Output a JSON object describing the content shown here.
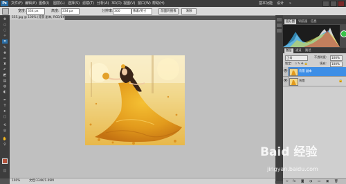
{
  "app": {
    "logo": "Ps"
  },
  "menu": [
    "文件(F)",
    "编辑(E)",
    "图像(I)",
    "图层(L)",
    "选择(S)",
    "滤镜(T)",
    "分析(A)",
    "3D(D)",
    "视图(V)",
    "窗口(W)",
    "帮助(H)"
  ],
  "workspace": {
    "basic": "基本功能",
    "design": "设计"
  },
  "options": {
    "width_label": "宽度:",
    "width_value": "334 px",
    "height_label": "高度:",
    "height_value": "334 px",
    "resolution_label": "分辨率:",
    "resolution_value": "300",
    "resolution_unit": "像素/英寸",
    "front_image_button": "前面的图像",
    "clear_button": "清除"
  },
  "document": {
    "tab_title": "555.jpg @ 100% (背景 副本, RGB/8#) *",
    "zoom": "100%",
    "doc_size": "文档:334K/1.09M"
  },
  "panels": {
    "histogram_tabs": [
      "直方图",
      "导航器",
      "信息"
    ],
    "layer_tabs": [
      "图层",
      "通道",
      "路径"
    ],
    "blend_mode": "正常",
    "opacity_label": "不透明度:",
    "opacity_value": "100%",
    "lock_label": "锁定:",
    "fill_label": "填充:",
    "fill_value": "100%",
    "layers": [
      {
        "name": "背景 副本",
        "selected": true
      },
      {
        "name": "背景",
        "selected": false
      }
    ]
  },
  "watermark": {
    "brand": "Baid 经验",
    "url": "jingyan.baidu.com"
  },
  "colors": {
    "accent": "#2a6ea6",
    "selected_layer": "#3d8ee6",
    "canvas_bg": "#c0c0c0"
  }
}
